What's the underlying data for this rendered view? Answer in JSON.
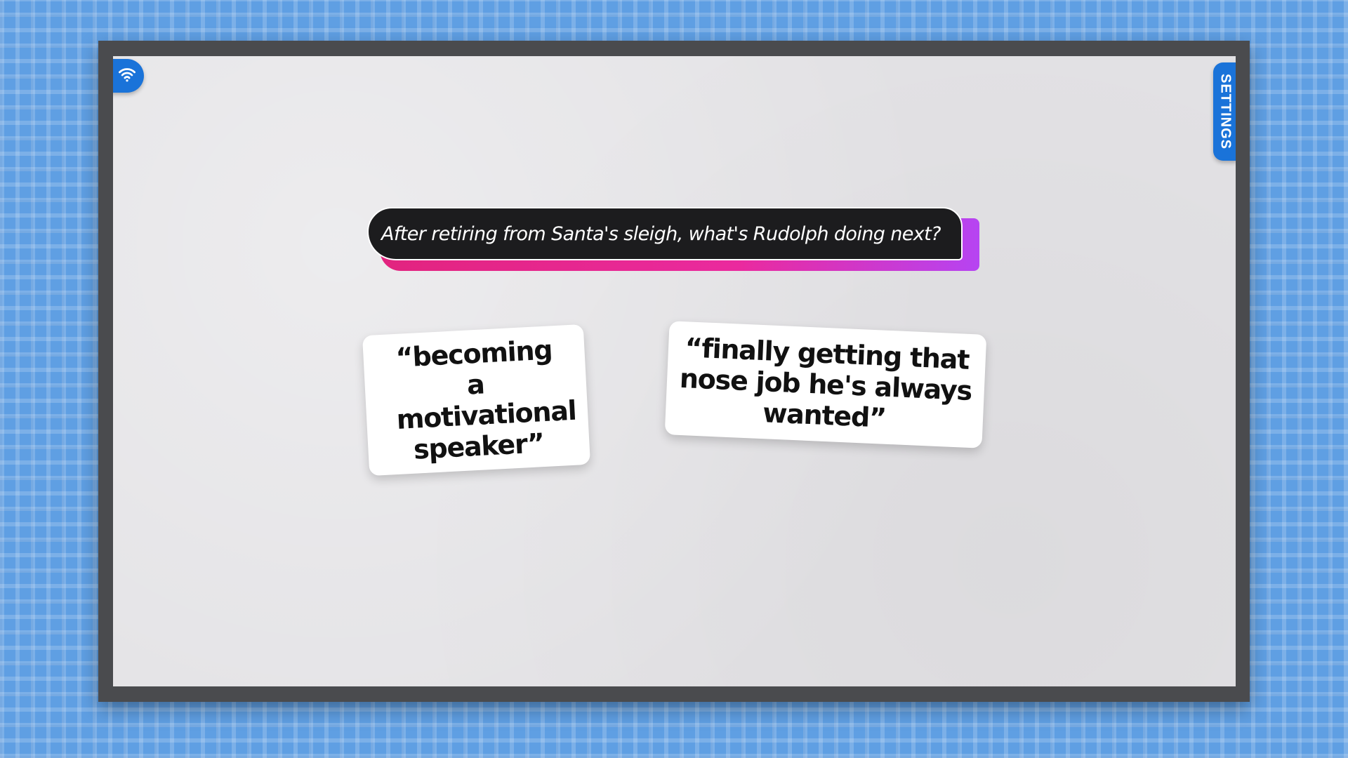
{
  "game": {
    "prompt": "After retiring from Santa's sleigh, what's Rudolph doing next?",
    "answers": [
      {
        "text": "“becoming a motivational speaker”"
      },
      {
        "text": "“finally getting that nose job he's always wanted”"
      }
    ]
  },
  "controls": {
    "settings_label": "SETTINGS",
    "connection_icon": "wifi-icon"
  },
  "colors": {
    "background": "#5f9fe3",
    "frame": "#4a4b4e",
    "screen": "#e3e2e5",
    "accent_blue": "#1a73d9",
    "prompt_bg": "#1c1c1e",
    "prompt_shadow_pink": "#e2247f",
    "prompt_shadow_purple": "#b644f2",
    "card_bg": "#ffffff"
  }
}
